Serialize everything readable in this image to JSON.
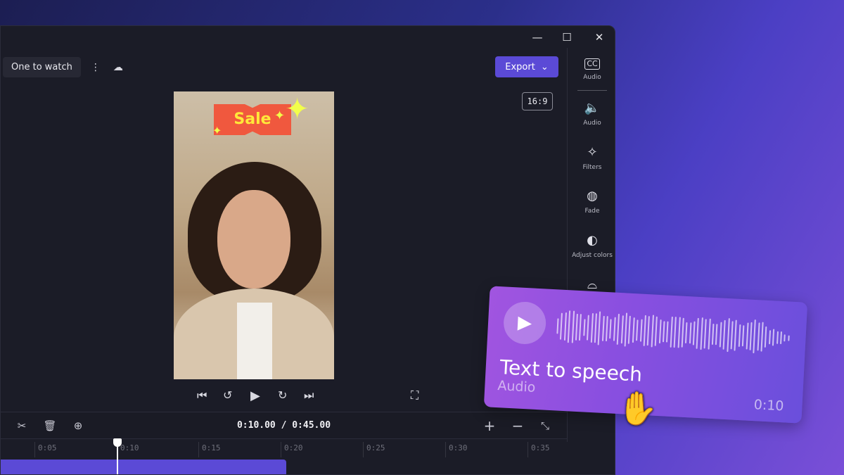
{
  "window": {
    "minimize": "—",
    "maximize": "☐",
    "close": "✕"
  },
  "toolbar": {
    "project_name": "One to watch",
    "more": "⋮",
    "cloud": "☁",
    "export_label": "Export",
    "export_chevron": "⌄",
    "aspect_ratio": "16:9"
  },
  "sidebar": {
    "items": [
      {
        "label": "Audio",
        "icon": "CC"
      },
      {
        "label": "Audio",
        "icon": "🔈"
      },
      {
        "label": "Filters",
        "icon": "✧"
      },
      {
        "label": "Fade",
        "icon": "◍"
      },
      {
        "label": "Adjust colors",
        "icon": "◐"
      },
      {
        "label": "",
        "icon": "⌓"
      }
    ]
  },
  "preview": {
    "sticker_text": "Sale"
  },
  "playback": {
    "skip_back": "⏮",
    "rewind": "↺",
    "play": "▶",
    "forward": "↻",
    "skip_forward": "⏭",
    "fullscreen": "⛶"
  },
  "timeline": {
    "current_time": "0:10.00 / 0:45.00",
    "cut": "✂",
    "delete": "🗑",
    "add": "⊕",
    "zoom_in": "+",
    "zoom_out": "−",
    "fit": "⤡",
    "ticks": [
      "0:05",
      "0:10",
      "0:15",
      "0:20",
      "0:25",
      "0:30",
      "0:35"
    ]
  },
  "card": {
    "title": "Text to speech",
    "subtitle": "Audio",
    "duration": "0:10",
    "play": "▶"
  },
  "colors": {
    "accent": "#5b4ad6",
    "card_start": "#a155e0",
    "card_end": "#6a4fdc",
    "background": "#1b1c27"
  }
}
